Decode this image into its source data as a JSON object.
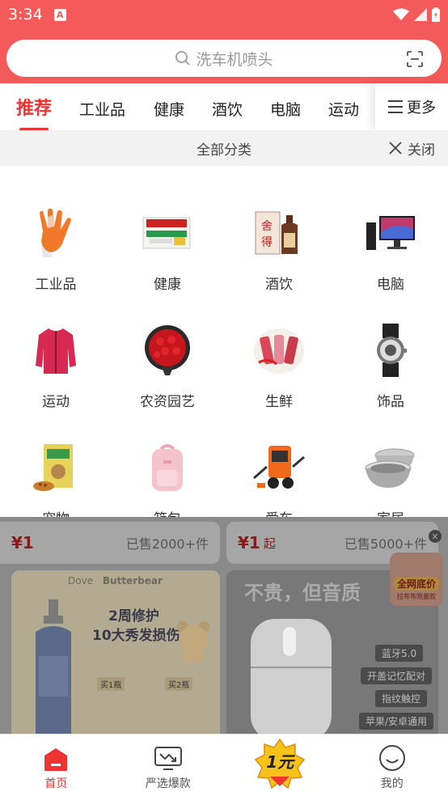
{
  "status": {
    "time": "3:34",
    "notif_icon": "A"
  },
  "search": {
    "placeholder": "洗车机喷头"
  },
  "tabs": [
    {
      "label": "推荐"
    },
    {
      "label": "工业品"
    },
    {
      "label": "健康"
    },
    {
      "label": "酒饮"
    },
    {
      "label": "电脑"
    },
    {
      "label": "运动"
    }
  ],
  "more_label": "更多",
  "all_categories": {
    "title": "全部分类",
    "close_label": "关闭"
  },
  "categories": [
    {
      "label": "工业品",
      "icon": "gloves-icon"
    },
    {
      "label": "健康",
      "icon": "medicine-box-icon"
    },
    {
      "label": "酒饮",
      "icon": "liquor-icon"
    },
    {
      "label": "电脑",
      "icon": "desktop-computer-icon"
    },
    {
      "label": "运动",
      "icon": "jacket-icon"
    },
    {
      "label": "农资园艺",
      "icon": "flower-bouquet-icon"
    },
    {
      "label": "生鲜",
      "icon": "meat-icon"
    },
    {
      "label": "饰品",
      "icon": "watch-icon"
    },
    {
      "label": "宠物",
      "icon": "pet-food-icon"
    },
    {
      "label": "箱包",
      "icon": "backpack-icon"
    },
    {
      "label": "爱车",
      "icon": "car-wash-icon"
    },
    {
      "label": "家居",
      "icon": "steel-bowl-icon"
    }
  ],
  "deals": [
    {
      "price": "¥1",
      "suffix": "",
      "sold": "已售2000+件"
    },
    {
      "price": "¥1",
      "suffix": "起",
      "sold": "已售5000+件"
    }
  ],
  "promo_left": {
    "brand1": "Dove",
    "brand2": "Butterbear",
    "line1": "2周修护",
    "line2": "10大秀发损伤",
    "tag1": "买1瓶",
    "tag2": "买2瓶"
  },
  "promo_right": {
    "headline": "不贵，但音质",
    "features": [
      "蓝牙5.0",
      "开盖记忆配对",
      "指纹触控",
      "苹果/安卓通用"
    ]
  },
  "float_badge": {
    "line1": "全网底价",
    "line2": "拉布布限量款"
  },
  "bottom_nav": [
    {
      "label": "首页",
      "active": true
    },
    {
      "label": "严选爆款",
      "active": false
    },
    {
      "label": "1元",
      "active": false
    },
    {
      "label": "我的",
      "active": false
    }
  ],
  "colors": {
    "brand": "#f55a5a",
    "accent": "#e33333"
  }
}
